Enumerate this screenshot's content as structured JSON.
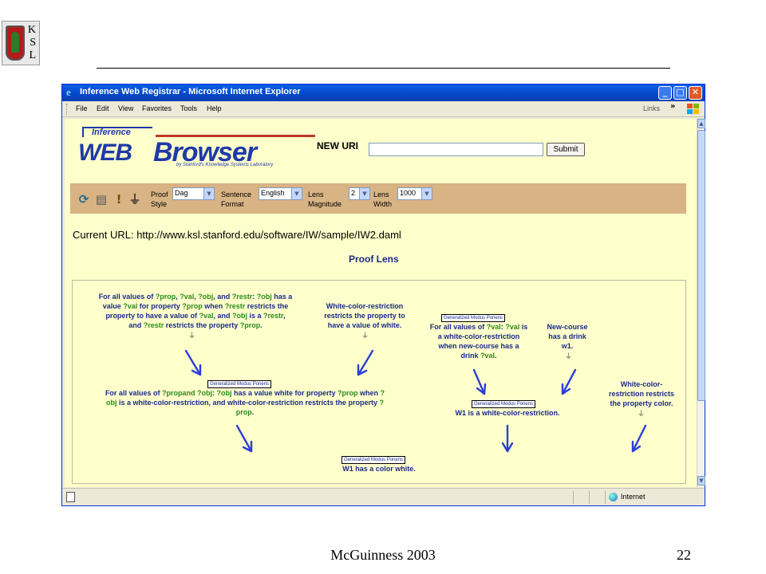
{
  "slide": {
    "logo_letters": [
      "K",
      "S",
      "L"
    ],
    "footer_author": "McGuinness 2003",
    "page_number": "22"
  },
  "window": {
    "title": "Inference Web Registrar - Microsoft Internet Explorer",
    "menu": [
      "File",
      "Edit",
      "View",
      "Favorites",
      "Tools",
      "Help"
    ],
    "links_label": "Links",
    "status_zone": "Internet"
  },
  "page": {
    "logo": {
      "inference": "Inference",
      "web": "WEB",
      "browser": "Browser",
      "tagline": "by Stanford's Knowledge Systems Laboratory"
    },
    "new_uri_label": "NEW URI",
    "uri_value": "",
    "submit_label": "Submit",
    "toolbar": {
      "proof_style_label_1": "Proof",
      "proof_style_label_2": "Style",
      "proof_style_value": "Dag",
      "sentence_format_label_1": "Sentence",
      "sentence_format_label_2": "Format",
      "sentence_format_value": "English",
      "lens_magnitude_label_1": "Lens",
      "lens_magnitude_label_2": "Magnitude",
      "lens_magnitude_value": "2",
      "lens_width_label_1": "Lens",
      "lens_width_label_2": "Width",
      "lens_width_value": "1000"
    },
    "current_url": "Current URL: http://www.ksl.stanford.edu/software/IW/sample/IW2.daml",
    "lens_heading": "Proof Lens",
    "proof": {
      "gmp_label": "Generalized Modus Ponens",
      "node_a": {
        "l1a": "For all values of ",
        "l1b": "?prop",
        "l1c": ", ",
        "l1d": "?val",
        "l1e": ", ",
        "l1f": "?obj",
        "l1g": ", and ",
        "l1h": "?restr",
        "l1i": ": ",
        "l1j": "?obj",
        "l1k": " has a",
        "l2a": "value ",
        "l2b": "?val",
        "l2c": " for property ",
        "l2d": "?prop",
        "l2e": " when ",
        "l2f": "?restr",
        "l2g": " restricts the",
        "l3a": "property to have a value of ",
        "l3b": "?val",
        "l3c": ", and ",
        "l3d": "?obj",
        "l3e": " is a ",
        "l3f": "?restr",
        "l3g": ",",
        "l4a": "and ",
        "l4b": "?restr",
        "l4c": " restricts the property ",
        "l4d": "?prop",
        "l4e": "."
      },
      "node_b": [
        "White-color-restriction",
        "restricts the property to",
        "have a value of white."
      ],
      "node_c": {
        "l1a": "For all values of ",
        "l1b": "?val",
        "l1c": ": ",
        "l1d": "?val",
        "l1e": " is",
        "l2": "a white-color-restriction",
        "l3": "when new-course has a",
        "l4a": "drink ",
        "l4b": "?val",
        "l4c": "."
      },
      "node_d": [
        "New-course",
        "has a drink",
        "w1."
      ],
      "node_e": {
        "l1a": "For all values of ",
        "l1b": "?propand",
        "l1c": " ",
        "l1d": "?obj",
        "l1e": ": ",
        "l1f": "?obj",
        "l1g": " has a value white for property ",
        "l1h": "?prop",
        "l1i": " when ",
        "l1j": "?",
        "l2a": "obj",
        "l2b": " is a white-color-restriction, and white-color-restriction restricts the property ",
        "l2c": "?",
        "l3a": "prop",
        "l3b": "."
      },
      "node_f": "W1 is a white-color-restriction.",
      "node_g": [
        "White-color-",
        "restriction restricts",
        "the property color."
      ],
      "node_h": "W1 has a color white."
    },
    "colors": {
      "page_bg": "#ffffcc",
      "toolbar_bg": "#d8b384",
      "text_blue": "#1a2a8a",
      "variable_green": "#2a8a1a",
      "arrow_blue": "#2b3fd6"
    }
  }
}
